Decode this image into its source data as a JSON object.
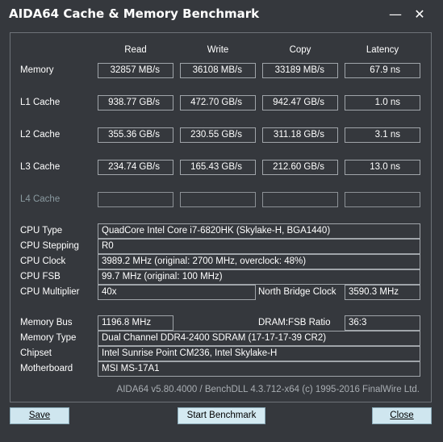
{
  "window": {
    "title": "AIDA64 Cache & Memory Benchmark",
    "minimize": "—",
    "close": "✕"
  },
  "columns": [
    "Read",
    "Write",
    "Copy",
    "Latency"
  ],
  "bench_rows": [
    {
      "label": "Memory",
      "values": [
        "32857 MB/s",
        "36108 MB/s",
        "33189 MB/s",
        "67.9 ns"
      ]
    },
    {
      "label": "L1 Cache",
      "values": [
        "938.77 GB/s",
        "472.70 GB/s",
        "942.47 GB/s",
        "1.0 ns"
      ]
    },
    {
      "label": "L2 Cache",
      "values": [
        "355.36 GB/s",
        "230.55 GB/s",
        "311.18 GB/s",
        "3.1 ns"
      ]
    },
    {
      "label": "L3 Cache",
      "values": [
        "234.74 GB/s",
        "165.43 GB/s",
        "212.60 GB/s",
        "13.0 ns"
      ]
    },
    {
      "label": "L4 Cache",
      "values": [
        "",
        "",
        "",
        ""
      ]
    }
  ],
  "cpu": {
    "type_label": "CPU Type",
    "type_value": "QuadCore Intel Core i7-6820HK  (Skylake-H, BGA1440)",
    "stepping_label": "CPU Stepping",
    "stepping_value": "R0",
    "clock_label": "CPU Clock",
    "clock_value": "3989.2 MHz  (original: 2700 MHz, overclock: 48%)",
    "fsb_label": "CPU FSB",
    "fsb_value": "99.7 MHz  (original: 100 MHz)",
    "multiplier_label": "CPU Multiplier",
    "multiplier_value": "40x",
    "nb_clock_label": "North Bridge Clock",
    "nb_clock_value": "3590.3 MHz"
  },
  "memory": {
    "bus_label": "Memory Bus",
    "bus_value": "1196.8 MHz",
    "ratio_label": "DRAM:FSB Ratio",
    "ratio_value": "36:3",
    "type_label": "Memory Type",
    "type_value": "Dual Channel DDR4-2400 SDRAM  (17-17-17-39 CR2)",
    "chipset_label": "Chipset",
    "chipset_value": "Intel Sunrise Point CM236, Intel Skylake-H",
    "motherboard_label": "Motherboard",
    "motherboard_value": "MSI MS-17A1"
  },
  "footer": "AIDA64 v5.80.4000 / BenchDLL 4.3.712-x64  (c) 1995-2016 FinalWire Ltd.",
  "buttons": {
    "save": "Save",
    "start": "Start Benchmark",
    "close": "Close"
  }
}
